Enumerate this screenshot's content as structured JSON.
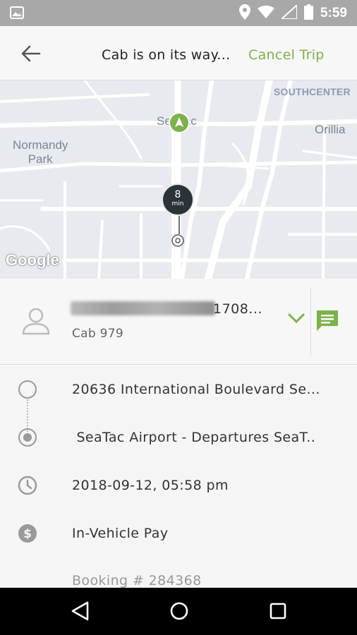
{
  "status_bar": {
    "time": "5:59",
    "icons": [
      "image-icon",
      "location-icon",
      "wifi-icon",
      "signal-icon",
      "battery-icon"
    ]
  },
  "header": {
    "title": "Cab is on its way...",
    "cancel_label": "Cancel Trip",
    "accent_color": "#7db24a"
  },
  "map": {
    "labels": {
      "southcenter": "SOUTHCENTER",
      "seatac": "SeaTac",
      "orillia": "Orillia",
      "normandy_park": "Normandy\nPark"
    },
    "google": "Google",
    "eta": {
      "value": "8",
      "unit": "min"
    }
  },
  "driver": {
    "name_suffix": "1708...",
    "cab": "Cab 979"
  },
  "trip": {
    "pickup": "20636 International Boulevard Se...",
    "dropoff": " SeaTac Airport - Departures SeaT..",
    "datetime": "2018-09-12, 05:58 pm",
    "payment": "In-Vehicle Pay",
    "booking": "Booking # 284368"
  }
}
